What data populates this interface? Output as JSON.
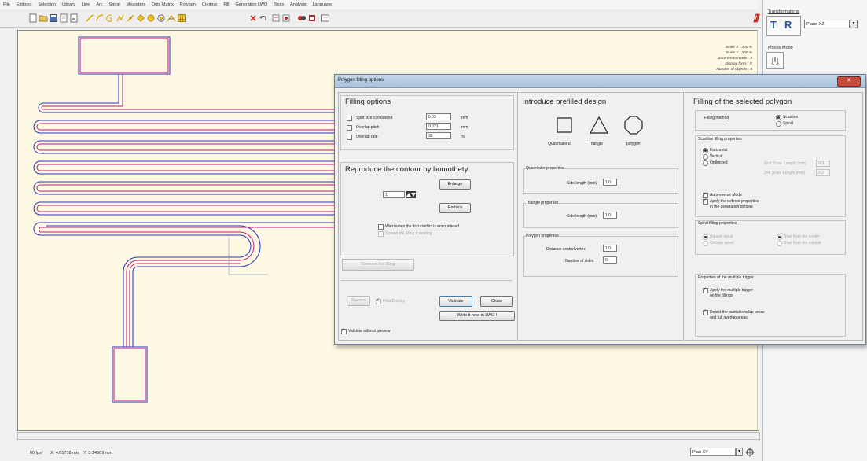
{
  "menu": [
    "File",
    "Editions",
    "Selection",
    "Library",
    "Line",
    "Arc",
    "Spiral",
    "Meanders",
    "Dots Matrix",
    "Polygon",
    "Contour",
    "Fill",
    "Generation LWO",
    "Tools",
    "Analysis",
    "Language"
  ],
  "canvas_info": {
    "lines": [
      "Scale X : 300 %",
      "Scale Y : 300 %",
      "Zoom/Auto mode : 4",
      "Display fonts : V",
      "Number of objects : 8"
    ]
  },
  "status": {
    "fps": "60 fps",
    "x": "X: 4.61718 mm",
    "y": "Y: 3.14509 mm",
    "plane": "Plan XY"
  },
  "right_panel": {
    "transformations": "Transformations",
    "plane_value": "Plane XZ",
    "mouse_mode": "Mouse Mode"
  },
  "dialog": {
    "title": "Polygon filling options",
    "filling_options": {
      "heading": "Filling options",
      "spot_label": "Spot size considered",
      "spot_value": "0.03",
      "spot_unit": "mm",
      "pitch_label": "Overlap pitch",
      "pitch_value": "0.021",
      "pitch_unit": "mm",
      "rate_label": "Overlap rate",
      "rate_value": "30",
      "rate_unit": "%"
    },
    "homothety": {
      "heading": "Reproduce the contour by homothety",
      "count": "1",
      "enlarge": "Enlarge",
      "reduce": "Reduce",
      "warn": "Warn when the first conflict is encountered",
      "spread": "Spread the filling if existing"
    },
    "remove": "Remove the filling",
    "preview": "Preview",
    "hide_display": "Hide Display",
    "validate": "Validate",
    "close": "Close",
    "write": "Write it now in LWO !",
    "validate_without_preview": "Validate without preview",
    "prefilled": {
      "heading": "Introduce prefilled design",
      "quad": "Quadrilateral",
      "tri": "Triangle",
      "poly": "polygon",
      "quad_props": "Quadrilater properties",
      "quad_side_label": "Side length (mm)",
      "quad_side": "1.0",
      "tri_props": "Triangle properties",
      "tri_side_label": "Side length (mm)",
      "tri_side": "1.0",
      "poly_props": "Polygon properties",
      "poly_dist_label": "Distance centre/vertex",
      "poly_dist": "1.0",
      "poly_sides_label": "Number of sides",
      "poly_sides": "6"
    },
    "selected": {
      "heading": "Filling of the selected polygon",
      "method_label": "Filling method",
      "scanline": "Scanline",
      "spiral": "Spiral",
      "scan_props": "Scanline filling properties",
      "horizontal": "Horizontal",
      "vertical": "Vertical",
      "optimized": "Optimized",
      "first_len": "First Scan. Length (mm)",
      "first_len_val": "0.3",
      "second_len": "2nd Scan. Length (mm)",
      "second_len_val": "0.2",
      "autoreverse": "Autoreverse Mode",
      "apply_defined_1": "Apply the defined properties",
      "apply_defined_2": "in the generation options",
      "spiral_props": "Spiral filling properties",
      "square_spiral": "Square spiral",
      "circular_spiral": "Circular spiral",
      "start_center": "Start from the center",
      "start_outside": "Start from the outside",
      "trigger_props": "Properties of the multiple trigger",
      "apply_trigger_1": "Apply the multiple trigger",
      "apply_trigger_2": "on the fillings",
      "detect_1": "Detect the partial overlap areas",
      "detect_2": "and full overlap areas"
    }
  },
  "colors": {
    "canvas_bg": "#fdf9e2",
    "path_outer": "#2b2fbf",
    "path_inner": "#c0187a",
    "accent_red": "#d42a1a"
  }
}
